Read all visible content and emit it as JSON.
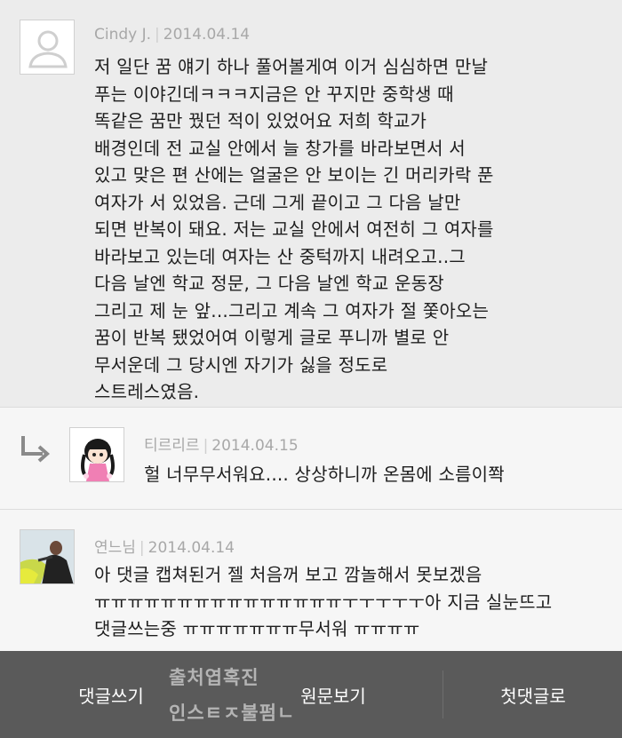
{
  "comments": [
    {
      "author": "Cindy J.",
      "date": "2014.04.14",
      "avatar_icon": "default-user-icon",
      "text": "저 일단 꿈 얘기 하나 풀어볼게여 이거 심심하면 만날\n푸는 이야긴데ㅋㅋㅋ지금은 안 꾸지만 중학생 때\n똑같은 꿈만 꿨던 적이 있었어요 저희 학교가\n배경인데 전 교실 안에서 늘 창가를 바라보면서 서\n있고 맞은 편 산에는 얼굴은 안 보이는 긴 머리카락 푼\n여자가 서 있었음. 근데 그게 끝이고 그 다음 날만\n되면 반복이 돼요. 저는 교실 안에서 여전히 그 여자를\n바라보고 있는데 여자는 산 중턱까지 내려오고..그\n다음 날엔 학교 정문, 그 다음 날엔 학교 운동장\n그리고 제 눈 앞...그리고 계속 그 여자가 절 쫓아오는\n꿈이 반복 됐었어여 이렇게 글로 푸니까 별로 안\n무서운데 그 당시엔 자기가 싫을 정도로\n스트레스였음."
    },
    {
      "author": "티르리르",
      "date": "2014.04.15",
      "avatar_icon": "girl-character-avatar",
      "reply_icon": "reply-arrow-icon",
      "text": "헐 너무무서워요.... 상상하니까 온몸에 소름이쫙"
    },
    {
      "author": "연느님",
      "date": "2014.04.14",
      "avatar_icon": "photo-avatar",
      "text": "아 댓글 캡쳐된거 젤 처음꺼 보고 깜놀해서 못보겠음\nㅠㅠㅠㅠㅠㅠㅠㅠㅠㅠㅠㅠㅠㅠㅠㅜㅜㅜㅜㅜ아 지금 실눈뜨고\n댓글쓰는중 ㅠㅠㅠㅠㅠㅠㅠ무서워 ㅠㅠㅠㅠ"
    }
  ],
  "bottom_bar": {
    "write_comment": "댓글쓰기",
    "view_original": "원문보기",
    "first_comment": "첫댓글로",
    "watermark": "출처엽혹진\n인스ㅌㅈ불펌ㄴ"
  },
  "colors": {
    "first_comment_bg": "#ececec",
    "comment_bg": "#f6f6f6",
    "bottom_bar_bg": "#5a5a5a",
    "meta_text": "#a8a8a8"
  }
}
